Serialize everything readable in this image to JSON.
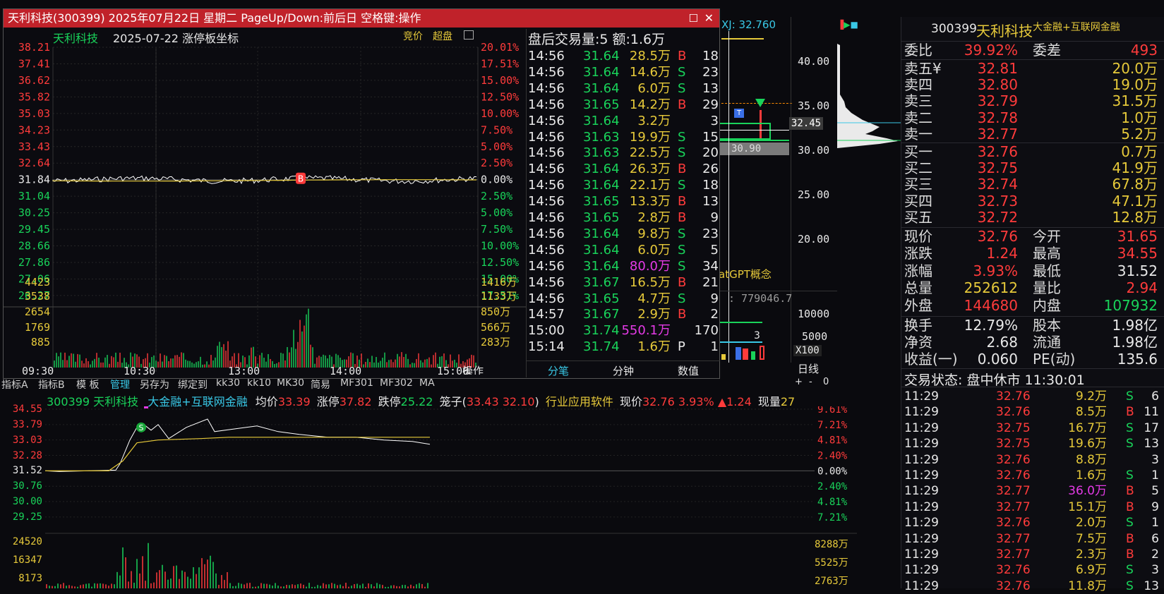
{
  "popup": {
    "title": "天利科技(300399) 2025年07月22日 星期二 PageUp/Down:前后日 空格键:操作",
    "stock_name": "天利科技",
    "date_label": "2025-07-22 涨停板坐标",
    "btn_jingjia": "竞价",
    "btn_chaopan": "超盘",
    "price_ticks": [
      "38.21",
      "37.41",
      "36.62",
      "35.82",
      "35.03",
      "34.23",
      "33.43",
      "32.64",
      "31.84",
      "31.04",
      "30.25",
      "29.45",
      "28.66",
      "27.86",
      "27.06",
      "26.27"
    ],
    "pct_ticks": [
      "20.01%",
      "17.51%",
      "15.00%",
      "12.50%",
      "10.00%",
      "7.50%",
      "5.00%",
      "2.50%",
      "0.00%",
      "2.50%",
      "5.00%",
      "7.50%",
      "10.00%",
      "12.50%",
      "15.00%",
      "17.51%"
    ],
    "vol_ticks_left": [
      "4423",
      "3538",
      "2654",
      "1769",
      "885"
    ],
    "vol_ticks_right": [
      "1416万",
      "1133万",
      "850万",
      "566万",
      "283万"
    ],
    "time_ticks": [
      "09:30",
      "10:30",
      "13:00",
      "14:00",
      "15:00"
    ],
    "operate_label": "操作",
    "marker_b": "B",
    "after_hours_title": "盘后交易量:5 额:1.6万",
    "trades": [
      {
        "t": "14:56",
        "p": "31.64",
        "a": "28.5万",
        "s": "B",
        "n": "18"
      },
      {
        "t": "14:56",
        "p": "31.64",
        "a": "14.6万",
        "s": "S",
        "n": "23"
      },
      {
        "t": "14:56",
        "p": "31.64",
        "a": "6.0万",
        "s": "S",
        "n": "13"
      },
      {
        "t": "14:56",
        "p": "31.65",
        "a": "14.2万",
        "s": "B",
        "n": "29"
      },
      {
        "t": "14:56",
        "p": "31.64",
        "a": "3.2万",
        "s": "",
        "n": "3"
      },
      {
        "t": "14:56",
        "p": "31.63",
        "a": "19.9万",
        "s": "S",
        "n": "15"
      },
      {
        "t": "14:56",
        "p": "31.63",
        "a": "22.5万",
        "s": "S",
        "n": "20"
      },
      {
        "t": "14:56",
        "p": "31.64",
        "a": "26.3万",
        "s": "B",
        "n": "26"
      },
      {
        "t": "14:56",
        "p": "31.64",
        "a": "22.1万",
        "s": "S",
        "n": "18"
      },
      {
        "t": "14:56",
        "p": "31.65",
        "a": "13.3万",
        "s": "B",
        "n": "13"
      },
      {
        "t": "14:56",
        "p": "31.65",
        "a": "2.8万",
        "s": "B",
        "n": "9"
      },
      {
        "t": "14:56",
        "p": "31.64",
        "a": "9.8万",
        "s": "S",
        "n": "23"
      },
      {
        "t": "14:56",
        "p": "31.64",
        "a": "6.0万",
        "s": "S",
        "n": "5"
      },
      {
        "t": "14:56",
        "p": "31.64",
        "a": "80.0万",
        "s": "S",
        "n": "34"
      },
      {
        "t": "14:56",
        "p": "31.67",
        "a": "16.5万",
        "s": "B",
        "n": "21"
      },
      {
        "t": "14:56",
        "p": "31.65",
        "a": "4.7万",
        "s": "S",
        "n": "9"
      },
      {
        "t": "14:57",
        "p": "31.67",
        "a": "2.9万",
        "s": "B",
        "n": "2"
      },
      {
        "t": "15:00",
        "p": "31.74",
        "a": "550.1万",
        "s": "",
        "n": "170"
      },
      {
        "t": "15:14",
        "p": "31.74",
        "a": "1.6万",
        "s": "P",
        "n": "1"
      }
    ],
    "tabs": [
      "分笔",
      "分钟",
      "数值"
    ]
  },
  "kline": {
    "xj": "XJ: 32.760",
    "y_ticks": [
      "40.00",
      "35.00",
      "30.00",
      "25.00",
      "20.00"
    ],
    "price_marker": "32.45",
    "low_marker": "30.90",
    "concept": "atGPT概念",
    "vol_value": ": 779046.7",
    "vol_ticks": [
      "10000",
      "5000"
    ],
    "vol_unit": "X100",
    "small_3": "3",
    "btn_daily": "日线",
    "btn_plus": "+",
    "btn_minus": "-",
    "btn_zero": "0",
    "t_marker": "T"
  },
  "toolbar": [
    "指标A",
    "指标B",
    "模 板",
    "管理",
    "另存为",
    "绑定到",
    "kk30",
    "kk10",
    "MK30",
    "简易",
    "MF301",
    "MF302",
    "MA"
  ],
  "intraday": {
    "code": "300399",
    "name": "天利科技",
    "concept": "大金融+互联网金融",
    "avg_label": "均价",
    "avg": "33.39",
    "limit_up_label": "涨停",
    "limit_up": "37.82",
    "limit_down_label": "跌停",
    "limit_down": "25.22",
    "cage_label": "笼子(",
    "cage": "33.43 32.10",
    "cage_close": ")",
    "industry": "行业应用软件",
    "price_label": "现价",
    "price": "32.76",
    "pct": "3.93%",
    "change": "▲1.24",
    "vol_label": "现量",
    "vol": "27",
    "price_ticks": [
      "34.55",
      "33.79",
      "33.03",
      "32.28",
      "31.52",
      "30.76",
      "30.00",
      "29.25"
    ],
    "pct_ticks": [
      "9.61%",
      "7.21%",
      "4.81%",
      "2.40%",
      "0.00%",
      "2.40%",
      "4.81%",
      "7.21%"
    ],
    "vol_ticks_left": [
      "24520",
      "16347",
      "8173"
    ],
    "vol_ticks_right": [
      "8288万",
      "5525万",
      "2763万"
    ],
    "marker_s": "S"
  },
  "quote": {
    "code": "300399",
    "name": "天利科技",
    "concept": "大金融+互联网金融",
    "weibi_label": "委比",
    "weibi": "39.92%",
    "weicha_label": "委差",
    "weicha": "493",
    "asks": [
      {
        "label": "卖五¥",
        "price": "32.81",
        "vol": "20.0万"
      },
      {
        "label": "卖四",
        "price": "32.80",
        "vol": "19.0万"
      },
      {
        "label": "卖三",
        "price": "32.79",
        "vol": "31.5万"
      },
      {
        "label": "卖二",
        "price": "32.78",
        "vol": "1.0万"
      },
      {
        "label": "卖一",
        "price": "32.77",
        "vol": "5.2万"
      }
    ],
    "bids": [
      {
        "label": "买一",
        "price": "32.76",
        "vol": "0.7万"
      },
      {
        "label": "买二",
        "price": "32.75",
        "vol": "41.9万"
      },
      {
        "label": "买三",
        "price": "32.74",
        "vol": "67.8万"
      },
      {
        "label": "买四",
        "price": "32.73",
        "vol": "47.1万"
      },
      {
        "label": "买五",
        "price": "32.72",
        "vol": "12.8万"
      }
    ],
    "stats": [
      {
        "l1": "现价",
        "v1": "32.76",
        "c1": "red",
        "l2": "今开",
        "v2": "31.65",
        "c2": "red"
      },
      {
        "l1": "涨跌",
        "v1": "1.24",
        "c1": "red",
        "l2": "最高",
        "v2": "34.55",
        "c2": "red"
      },
      {
        "l1": "涨幅",
        "v1": "3.93%",
        "c1": "red",
        "l2": "最低",
        "v2": "31.52",
        "c2": "white"
      },
      {
        "l1": "总量",
        "v1": "252612",
        "c1": "yellow",
        "l2": "量比",
        "v2": "2.94",
        "c2": "red"
      },
      {
        "l1": "外盘",
        "v1": "144680",
        "c1": "red",
        "l2": "内盘",
        "v2": "107932",
        "c2": "green"
      }
    ],
    "stats2": [
      {
        "l1": "换手",
        "v1": "12.79%",
        "c1": "white",
        "l2": "股本",
        "v2": "1.98亿",
        "c2": "white"
      },
      {
        "l1": "净资",
        "v1": "2.68",
        "c1": "white",
        "l2": "流通",
        "v2": "1.98亿",
        "c2": "white"
      },
      {
        "l1": "收益(一)",
        "v1": "0.060",
        "c1": "white",
        "l2": "PE(动)",
        "v2": "135.6",
        "c2": "white"
      }
    ],
    "status": "交易状态: 盘中休市 11:30:01",
    "ticks": [
      {
        "t": "11:29",
        "p": "32.76",
        "a": "9.2万",
        "s": "S",
        "n": "6"
      },
      {
        "t": "11:29",
        "p": "32.76",
        "a": "8.5万",
        "s": "B",
        "n": "11"
      },
      {
        "t": "11:29",
        "p": "32.75",
        "a": "16.7万",
        "s": "S",
        "n": "17"
      },
      {
        "t": "11:29",
        "p": "32.75",
        "a": "19.6万",
        "s": "S",
        "n": "13"
      },
      {
        "t": "11:29",
        "p": "32.76",
        "a": "8.8万",
        "s": "",
        "n": "3"
      },
      {
        "t": "11:29",
        "p": "32.76",
        "a": "1.6万",
        "s": "S",
        "n": "1"
      },
      {
        "t": "11:29",
        "p": "32.77",
        "a": "36.0万",
        "s": "B",
        "n": "5"
      },
      {
        "t": "11:29",
        "p": "32.77",
        "a": "15.1万",
        "s": "B",
        "n": "9"
      },
      {
        "t": "11:29",
        "p": "32.76",
        "a": "2.0万",
        "s": "S",
        "n": "1"
      },
      {
        "t": "11:29",
        "p": "32.77",
        "a": "7.5万",
        "s": "B",
        "n": "6"
      },
      {
        "t": "11:29",
        "p": "32.77",
        "a": "2.3万",
        "s": "B",
        "n": "2"
      },
      {
        "t": "11:29",
        "p": "32.76",
        "a": "6.9万",
        "s": "S",
        "n": "3"
      },
      {
        "t": "11:29",
        "p": "32.76",
        "a": "11.8万",
        "s": "S",
        "n": "13"
      }
    ]
  },
  "colors": {
    "up": "#ff3b3b",
    "down": "#19d35a",
    "title_bar": "#c0222a",
    "avg_line": "#e6c93a",
    "price_line": "#ffffff"
  }
}
